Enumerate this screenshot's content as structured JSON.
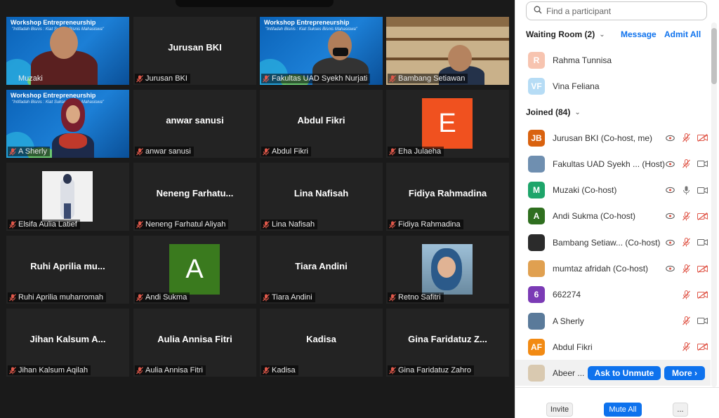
{
  "gallery": {
    "tiles": [
      {
        "name": "Muzaki",
        "center": "",
        "kind": "banner-person"
      },
      {
        "name": "Jurusan BKI",
        "center": "Jurusan BKI",
        "kind": "text"
      },
      {
        "name": "Fakultas UAD Syekh Nurjati",
        "center": "",
        "kind": "banner-person2"
      },
      {
        "name": "Bambang Setiawan",
        "center": "",
        "kind": "shelf-person"
      },
      {
        "name": "A Sherly",
        "center": "",
        "kind": "banner-sherly"
      },
      {
        "name": "anwar sanusi",
        "center": "anwar sanusi",
        "kind": "text"
      },
      {
        "name": "Abdul Fikri",
        "center": "Abdul Fikri",
        "kind": "text"
      },
      {
        "name": "Eha Julaeha",
        "center": "",
        "kind": "avatar",
        "letter": "E",
        "color": "#f0511f"
      },
      {
        "name": "Elsifa Aulia Latief",
        "center": "",
        "kind": "photo-white"
      },
      {
        "name": "Neneng Farhatul Aliyah",
        "center": "Neneng  Farhatu...",
        "kind": "text"
      },
      {
        "name": "Lina Nafisah",
        "center": "Lina Nafisah",
        "kind": "text"
      },
      {
        "name": "Fidiya Rahmadina",
        "center": "Fidiya Rahmadina",
        "kind": "text"
      },
      {
        "name": "Ruhi Aprilia muharromah",
        "center": "Ruhi Aprilia mu...",
        "kind": "text"
      },
      {
        "name": "Andi Sukma",
        "center": "",
        "kind": "avatar",
        "letter": "A",
        "color": "#3a7a1e"
      },
      {
        "name": "Tiara Andini",
        "center": "Tiara Andini",
        "kind": "text"
      },
      {
        "name": "Retno Safitri",
        "center": "",
        "kind": "photo-hijab"
      },
      {
        "name": "Jihan Kalsum Aqilah",
        "center": "Jihan Kalsum A...",
        "kind": "text"
      },
      {
        "name": "Aulia Annisa Fitri",
        "center": "Aulia Annisa Fitri",
        "kind": "text"
      },
      {
        "name": "Kadisa",
        "center": "Kadisa",
        "kind": "text"
      },
      {
        "name": "Gina Faridatuz Zahro",
        "center": "Gina Faridatuz Z...",
        "kind": "text"
      }
    ],
    "banner_title": "Workshop Entrepreneurship",
    "banner_sub": "\"Intifadah Bisnis : Kiat Sukses Bisnis Mahasiswa\""
  },
  "panel": {
    "search_placeholder": "Find a participant",
    "waiting_label": "Waiting Room (2)",
    "message_label": "Message",
    "admit_all_label": "Admit All",
    "waiting": [
      {
        "initials": "R",
        "name": "Rahma Tunnisa",
        "color": "#f7c4b0"
      },
      {
        "initials": "VF",
        "name": "Vina Feliana",
        "color": "#b6dcf5"
      }
    ],
    "joined_label": "Joined (84)",
    "joined": [
      {
        "initials": "JB",
        "name": "Jurusan BKI (Co-host, me)",
        "color": "#d9620f",
        "video_off": true,
        "mic": "off",
        "share": true
      },
      {
        "initials": "",
        "name": "Fakultas UAD Syekh ... (Host)",
        "color": "#6f8fb0",
        "video_off": false,
        "mic": "off",
        "share": true
      },
      {
        "initials": "M",
        "name": "Muzaki (Co-host)",
        "color": "#1ea56a",
        "video_off": false,
        "mic": "on",
        "share": true
      },
      {
        "initials": "A",
        "name": "Andi Sukma (Co-host)",
        "color": "#2f6f1f",
        "video_off": true,
        "mic": "off",
        "share": true
      },
      {
        "initials": "",
        "name": "Bambang Setiaw... (Co-host)",
        "color": "#2b2b2b",
        "video_off": false,
        "mic": "off",
        "share": true
      },
      {
        "initials": "",
        "name": "mumtaz afridah (Co-host)",
        "color": "#e0a050",
        "video_off": true,
        "mic": "off",
        "share": true
      },
      {
        "initials": "6",
        "name": "662274",
        "color": "#7b3bb5",
        "video_off": true,
        "mic": "off",
        "share": false
      },
      {
        "initials": "",
        "name": "A Sherly",
        "color": "#5a7a9a",
        "video_off": false,
        "mic": "off",
        "share": false
      },
      {
        "initials": "AF",
        "name": "Abdul Fikri",
        "color": "#f28a13",
        "video_off": true,
        "mic": "off",
        "share": false
      }
    ],
    "hover_row": {
      "name": "Abeer ...",
      "color": "#d9c9b0"
    },
    "ask_unmute_label": "Ask to Unmute",
    "more_label": "More ›",
    "invite_label": "Invite",
    "mute_all_label": "Mute All",
    "more_dots_label": "..."
  }
}
